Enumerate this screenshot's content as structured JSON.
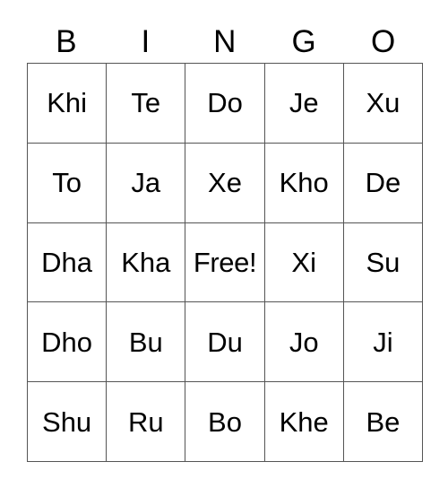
{
  "card": {
    "type": "bingo-card",
    "headers": [
      "B",
      "I",
      "N",
      "G",
      "O"
    ],
    "colors": {
      "grid_line": "#555555",
      "text": "#000000",
      "background": "#ffffff"
    },
    "rows": [
      {
        "cells": [
          {
            "label": "Khi",
            "free": false
          },
          {
            "label": "Te",
            "free": false
          },
          {
            "label": "Do",
            "free": false
          },
          {
            "label": "Je",
            "free": false
          },
          {
            "label": "Xu",
            "free": false
          }
        ]
      },
      {
        "cells": [
          {
            "label": "To",
            "free": false
          },
          {
            "label": "Ja",
            "free": false
          },
          {
            "label": "Xe",
            "free": false
          },
          {
            "label": "Kho",
            "free": false
          },
          {
            "label": "De",
            "free": false
          }
        ]
      },
      {
        "cells": [
          {
            "label": "Dha",
            "free": false
          },
          {
            "label": "Kha",
            "free": false
          },
          {
            "label": "Free!",
            "free": true
          },
          {
            "label": "Xi",
            "free": false
          },
          {
            "label": "Su",
            "free": false
          }
        ]
      },
      {
        "cells": [
          {
            "label": "Dho",
            "free": false
          },
          {
            "label": "Bu",
            "free": false
          },
          {
            "label": "Du",
            "free": false
          },
          {
            "label": "Jo",
            "free": false
          },
          {
            "label": "Ji",
            "free": false
          }
        ]
      },
      {
        "cells": [
          {
            "label": "Shu",
            "free": false
          },
          {
            "label": "Ru",
            "free": false
          },
          {
            "label": "Bo",
            "free": false
          },
          {
            "label": "Khe",
            "free": false
          },
          {
            "label": "Be",
            "free": false
          }
        ]
      }
    ]
  }
}
